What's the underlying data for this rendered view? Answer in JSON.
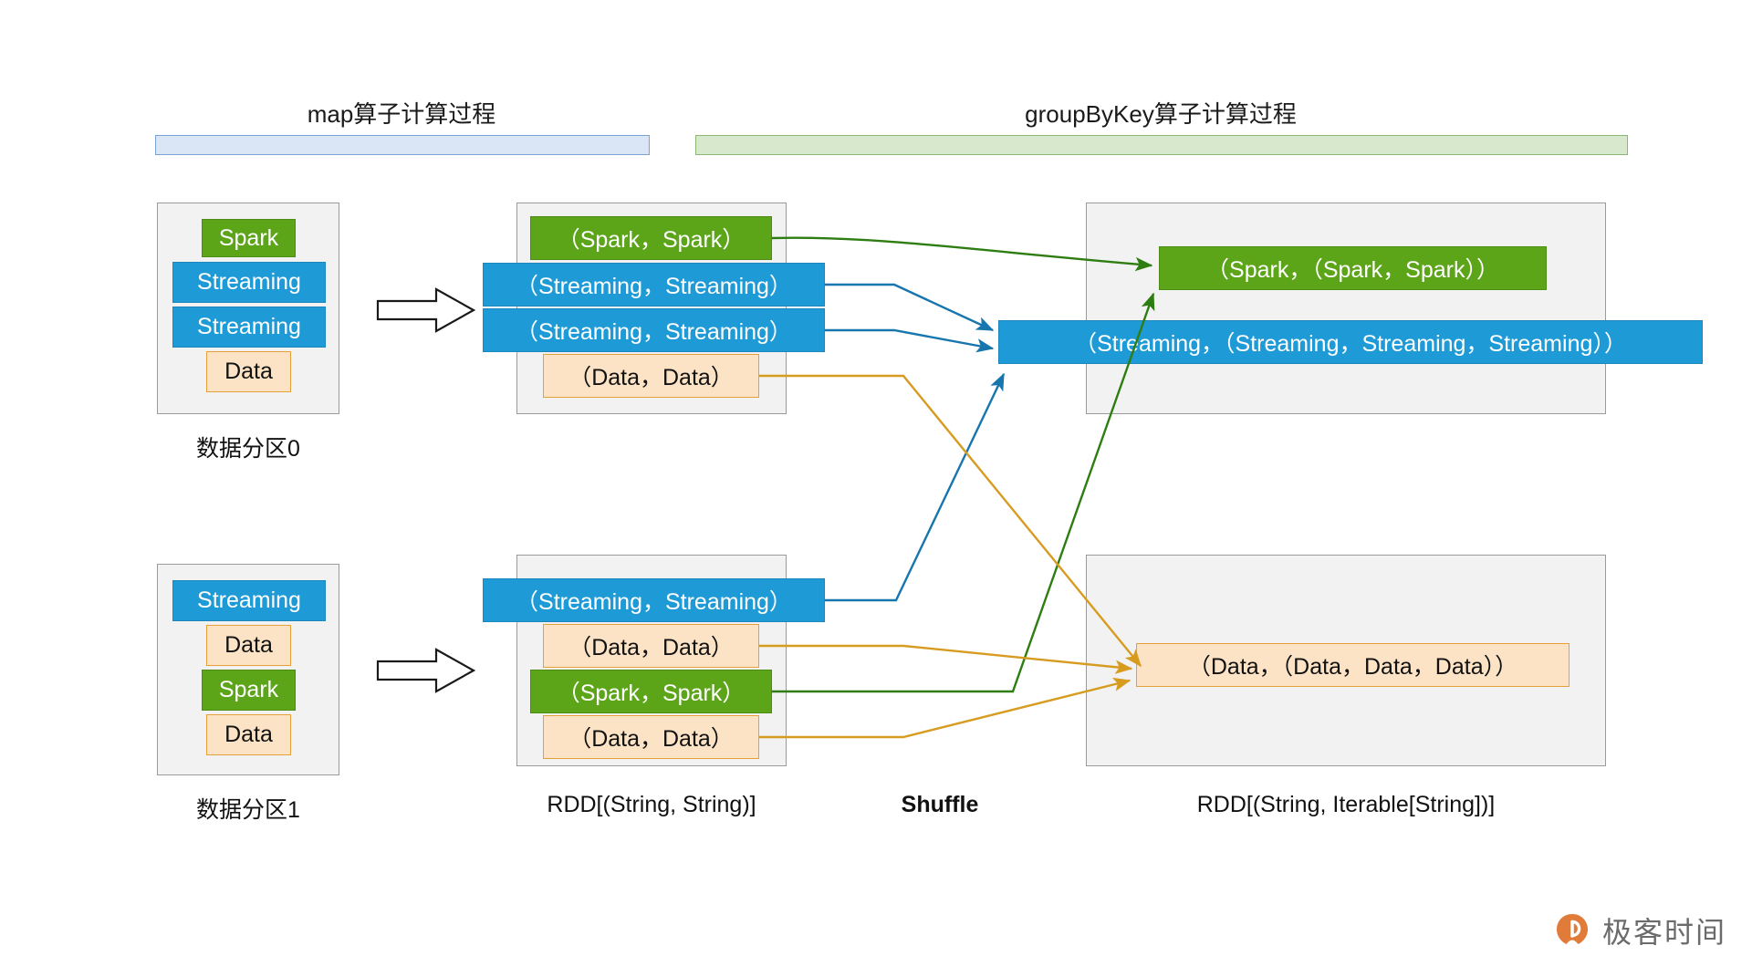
{
  "sections": [
    {
      "id": "map",
      "title": "map算子计算过程",
      "bar_color": "#dae6f5",
      "bar_border": "#7ba3d6"
    },
    {
      "id": "groupByKey",
      "title": "groupByKey算子计算过程",
      "bar_color": "#d8e8cd",
      "bar_border": "#8cb877"
    }
  ],
  "palette": {
    "green_fill": "#5ca518",
    "green_border": "#4c8c14",
    "blue_fill": "#1e9ad6",
    "blue_border": "#1b87bc",
    "orange_fill": "#fce3c5",
    "orange_border": "#e5a03a",
    "panel_fill": "#f2f2f2",
    "panel_border": "#9a9a9a",
    "arrow_green": "#2e7d12",
    "arrow_blue": "#1676ad",
    "arrow_orange": "#d79b20",
    "watermark": "#e07b39"
  },
  "partitions": [
    {
      "id": "partition-0",
      "caption": "数据分区0",
      "items": [
        {
          "label": "Spark",
          "color": "green"
        },
        {
          "label": "Streaming",
          "color": "blue"
        },
        {
          "label": "Streaming",
          "color": "blue"
        },
        {
          "label": "Data",
          "color": "orange"
        }
      ]
    },
    {
      "id": "partition-1",
      "caption": "数据分区1",
      "items": [
        {
          "label": "Streaming",
          "color": "blue"
        },
        {
          "label": "Data",
          "color": "orange"
        },
        {
          "label": "Spark",
          "color": "green"
        },
        {
          "label": "Data",
          "color": "orange"
        }
      ]
    }
  ],
  "mapped_rdd": {
    "caption": "RDD[(String, String)]",
    "blocks": [
      {
        "id": "mapped-0",
        "items": [
          {
            "label": "（Spark，Spark）",
            "color": "green"
          },
          {
            "label": "（Streaming，Streaming）",
            "color": "blue"
          },
          {
            "label": "（Streaming，Streaming）",
            "color": "blue"
          },
          {
            "label": "（Data，Data）",
            "color": "orange"
          }
        ]
      },
      {
        "id": "mapped-1",
        "items": [
          {
            "label": "（Streaming，Streaming）",
            "color": "blue"
          },
          {
            "label": "（Data，Data）",
            "color": "orange"
          },
          {
            "label": "（Spark，Spark）",
            "color": "green"
          },
          {
            "label": "（Data，Data）",
            "color": "orange"
          }
        ]
      }
    ]
  },
  "grouped_rdd": {
    "caption": "RDD[(String, Iterable[String])]",
    "blocks": [
      {
        "id": "grouped-0",
        "items": [
          {
            "label": "（Spark，（Spark，Spark））",
            "color": "green"
          },
          {
            "label": "（Streaming，（Streaming，Streaming，Streaming））",
            "color": "blue"
          }
        ]
      },
      {
        "id": "grouped-1",
        "items": [
          {
            "label": "（Data，（Data，Data，Data））",
            "color": "orange"
          }
        ]
      }
    ]
  },
  "shuffle_label": "Shuffle",
  "map_arrows": [
    {
      "id": "map-arrow-top"
    },
    {
      "id": "map-arrow-bottom"
    }
  ],
  "watermark": {
    "text": "极客时间",
    "mark": "geektime-logo"
  }
}
